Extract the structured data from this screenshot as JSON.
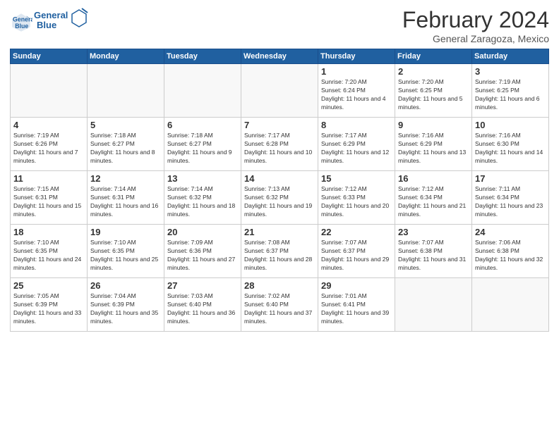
{
  "header": {
    "logo_line1": "General",
    "logo_line2": "Blue",
    "title": "February 2024",
    "subtitle": "General Zaragoza, Mexico"
  },
  "weekdays": [
    "Sunday",
    "Monday",
    "Tuesday",
    "Wednesday",
    "Thursday",
    "Friday",
    "Saturday"
  ],
  "weeks": [
    [
      {
        "day": "",
        "empty": true
      },
      {
        "day": "",
        "empty": true
      },
      {
        "day": "",
        "empty": true
      },
      {
        "day": "",
        "empty": true
      },
      {
        "day": "1",
        "sunrise": "7:20 AM",
        "sunset": "6:24 PM",
        "daylight": "11 hours and 4 minutes."
      },
      {
        "day": "2",
        "sunrise": "7:20 AM",
        "sunset": "6:25 PM",
        "daylight": "11 hours and 5 minutes."
      },
      {
        "day": "3",
        "sunrise": "7:19 AM",
        "sunset": "6:25 PM",
        "daylight": "11 hours and 6 minutes."
      }
    ],
    [
      {
        "day": "4",
        "sunrise": "7:19 AM",
        "sunset": "6:26 PM",
        "daylight": "11 hours and 7 minutes."
      },
      {
        "day": "5",
        "sunrise": "7:18 AM",
        "sunset": "6:27 PM",
        "daylight": "11 hours and 8 minutes."
      },
      {
        "day": "6",
        "sunrise": "7:18 AM",
        "sunset": "6:27 PM",
        "daylight": "11 hours and 9 minutes."
      },
      {
        "day": "7",
        "sunrise": "7:17 AM",
        "sunset": "6:28 PM",
        "daylight": "11 hours and 10 minutes."
      },
      {
        "day": "8",
        "sunrise": "7:17 AM",
        "sunset": "6:29 PM",
        "daylight": "11 hours and 12 minutes."
      },
      {
        "day": "9",
        "sunrise": "7:16 AM",
        "sunset": "6:29 PM",
        "daylight": "11 hours and 13 minutes."
      },
      {
        "day": "10",
        "sunrise": "7:16 AM",
        "sunset": "6:30 PM",
        "daylight": "11 hours and 14 minutes."
      }
    ],
    [
      {
        "day": "11",
        "sunrise": "7:15 AM",
        "sunset": "6:31 PM",
        "daylight": "11 hours and 15 minutes."
      },
      {
        "day": "12",
        "sunrise": "7:14 AM",
        "sunset": "6:31 PM",
        "daylight": "11 hours and 16 minutes."
      },
      {
        "day": "13",
        "sunrise": "7:14 AM",
        "sunset": "6:32 PM",
        "daylight": "11 hours and 18 minutes."
      },
      {
        "day": "14",
        "sunrise": "7:13 AM",
        "sunset": "6:32 PM",
        "daylight": "11 hours and 19 minutes."
      },
      {
        "day": "15",
        "sunrise": "7:12 AM",
        "sunset": "6:33 PM",
        "daylight": "11 hours and 20 minutes."
      },
      {
        "day": "16",
        "sunrise": "7:12 AM",
        "sunset": "6:34 PM",
        "daylight": "11 hours and 21 minutes."
      },
      {
        "day": "17",
        "sunrise": "7:11 AM",
        "sunset": "6:34 PM",
        "daylight": "11 hours and 23 minutes."
      }
    ],
    [
      {
        "day": "18",
        "sunrise": "7:10 AM",
        "sunset": "6:35 PM",
        "daylight": "11 hours and 24 minutes."
      },
      {
        "day": "19",
        "sunrise": "7:10 AM",
        "sunset": "6:35 PM",
        "daylight": "11 hours and 25 minutes."
      },
      {
        "day": "20",
        "sunrise": "7:09 AM",
        "sunset": "6:36 PM",
        "daylight": "11 hours and 27 minutes."
      },
      {
        "day": "21",
        "sunrise": "7:08 AM",
        "sunset": "6:37 PM",
        "daylight": "11 hours and 28 minutes."
      },
      {
        "day": "22",
        "sunrise": "7:07 AM",
        "sunset": "6:37 PM",
        "daylight": "11 hours and 29 minutes."
      },
      {
        "day": "23",
        "sunrise": "7:07 AM",
        "sunset": "6:38 PM",
        "daylight": "11 hours and 31 minutes."
      },
      {
        "day": "24",
        "sunrise": "7:06 AM",
        "sunset": "6:38 PM",
        "daylight": "11 hours and 32 minutes."
      }
    ],
    [
      {
        "day": "25",
        "sunrise": "7:05 AM",
        "sunset": "6:39 PM",
        "daylight": "11 hours and 33 minutes."
      },
      {
        "day": "26",
        "sunrise": "7:04 AM",
        "sunset": "6:39 PM",
        "daylight": "11 hours and 35 minutes."
      },
      {
        "day": "27",
        "sunrise": "7:03 AM",
        "sunset": "6:40 PM",
        "daylight": "11 hours and 36 minutes."
      },
      {
        "day": "28",
        "sunrise": "7:02 AM",
        "sunset": "6:40 PM",
        "daylight": "11 hours and 37 minutes."
      },
      {
        "day": "29",
        "sunrise": "7:01 AM",
        "sunset": "6:41 PM",
        "daylight": "11 hours and 39 minutes."
      },
      {
        "day": "",
        "empty": true
      },
      {
        "day": "",
        "empty": true
      }
    ]
  ]
}
